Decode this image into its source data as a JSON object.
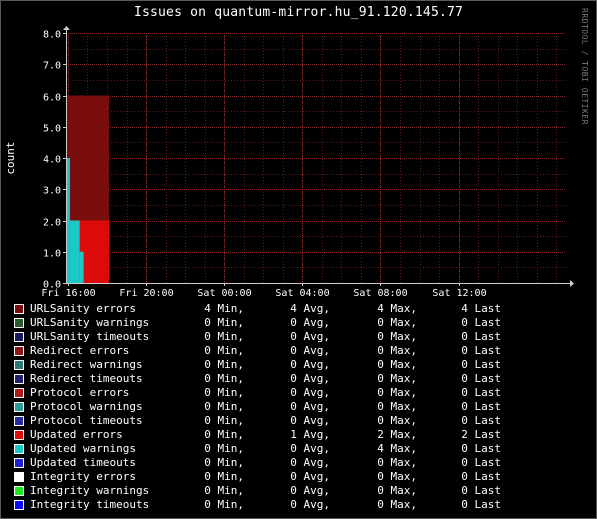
{
  "chart_data": {
    "type": "area",
    "title": "Issues on quantum-mirror.hu_91.120.145.77",
    "ylabel": "count",
    "watermark": "RRDTOOL / TOBI OETIKER",
    "ylim": [
      0,
      8
    ],
    "y_ticks": [
      "0.0",
      "1.0",
      "2.0",
      "3.0",
      "4.0",
      "5.0",
      "6.0",
      "7.0",
      "8.0"
    ],
    "x_range": [
      -0.05,
      12.75
    ],
    "x_ticks": [
      {
        "x": 0,
        "label": "Fri 16:00"
      },
      {
        "x": 2,
        "label": "Fri 20:00"
      },
      {
        "x": 4,
        "label": "Sat 00:00"
      },
      {
        "x": 6,
        "label": "Sat 04:00"
      },
      {
        "x": 8,
        "label": "Sat 08:00"
      },
      {
        "x": 10,
        "label": "Sat 12:00"
      }
    ],
    "grid": true,
    "series": [
      {
        "name": "URLSanity errors",
        "color": "#7a0e0e",
        "segments": [
          {
            "x0": -2.35,
            "x1": -2.05,
            "y": 6
          },
          {
            "x0": -2.05,
            "x1": -0.05,
            "y": 4
          },
          {
            "x0": -0.05,
            "x1": 1.05,
            "y": 6
          }
        ]
      },
      {
        "name": "Updated errors",
        "color": "#dd0a0a",
        "segments": [
          {
            "x0": -2.35,
            "x1": -2.05,
            "y": 2
          },
          {
            "x0": 0.2,
            "x1": 1.05,
            "y": 2
          }
        ]
      },
      {
        "name": "Updated warnings",
        "color": "#1dc8c8",
        "segments": [
          {
            "x0": -0.05,
            "x1": 0.05,
            "y": 4
          },
          {
            "x0": 0.05,
            "x1": 0.3,
            "y": 2
          },
          {
            "x0": 0.3,
            "x1": 0.4,
            "y": 1
          }
        ]
      }
    ],
    "legend": [
      {
        "name": "URLSanity errors",
        "color": "#7a0e0e",
        "min": "4",
        "avg": "4",
        "max": "4",
        "last": "4"
      },
      {
        "name": "URLSanity warnings",
        "color": "#2d5a2d",
        "min": "0",
        "avg": "0",
        "max": "0",
        "last": "0"
      },
      {
        "name": "URLSanity timeouts",
        "color": "#1a1a5e",
        "min": "0",
        "avg": "0",
        "max": "0",
        "last": "0"
      },
      {
        "name": "Redirect errors",
        "color": "#8a1818",
        "min": "0",
        "avg": "0",
        "max": "0",
        "last": "0"
      },
      {
        "name": "Redirect warnings",
        "color": "#307878",
        "min": "0",
        "avg": "0",
        "max": "0",
        "last": "0"
      },
      {
        "name": "Redirect timeouts",
        "color": "#202070",
        "min": "0",
        "avg": "0",
        "max": "0",
        "last": "0"
      },
      {
        "name": "Protocol errors",
        "color": "#a81c1c",
        "min": "0",
        "avg": "0",
        "max": "0",
        "last": "0"
      },
      {
        "name": "Protocol warnings",
        "color": "#2f9c9c",
        "min": "0",
        "avg": "0",
        "max": "0",
        "last": "0"
      },
      {
        "name": "Protocol timeouts",
        "color": "#2a2aa0",
        "min": "0",
        "avg": "0",
        "max": "0",
        "last": "0"
      },
      {
        "name": "Updated errors",
        "color": "#dd0a0a",
        "min": "0",
        "avg": "1",
        "max": "2",
        "last": "2"
      },
      {
        "name": "Updated warnings",
        "color": "#1dc8c8",
        "min": "0",
        "avg": "0",
        "max": "4",
        "last": "0"
      },
      {
        "name": "Updated timeouts",
        "color": "#2020d0",
        "min": "0",
        "avg": "0",
        "max": "0",
        "last": "0"
      },
      {
        "name": "Integrity errors",
        "color": "#ffffff",
        "min": "0",
        "avg": "0",
        "max": "0",
        "last": "0"
      },
      {
        "name": "Integrity warnings",
        "color": "#1ee81e",
        "min": "0",
        "avg": "0",
        "max": "0",
        "last": "0"
      },
      {
        "name": "Integrity timeouts",
        "color": "#0a0aff",
        "min": "0",
        "avg": "0",
        "max": "0",
        "last": "0"
      }
    ],
    "legend_labels": {
      "min": "Min,",
      "avg": "Avg,",
      "max": "Max,",
      "last": "Last"
    }
  }
}
